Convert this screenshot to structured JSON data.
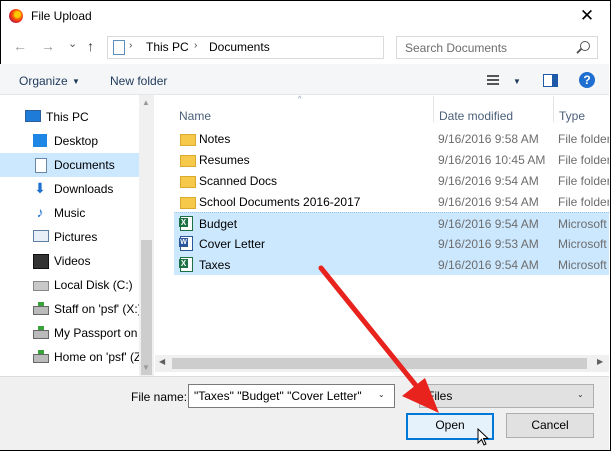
{
  "window": {
    "title": "File Upload",
    "close_glyph": "✕"
  },
  "nav": {
    "back": "←",
    "forward": "→",
    "recent": "⌄",
    "up": "↑"
  },
  "address": {
    "crumbs": [
      "This PC",
      "Documents"
    ],
    "separator": "›",
    "dropdown": "⌄",
    "refresh": "↻"
  },
  "search": {
    "placeholder": "Search Documents"
  },
  "toolbar": {
    "organize": "Organize",
    "caret": "▼",
    "new_folder": "New folder",
    "help": "?"
  },
  "sidebar": {
    "items": [
      {
        "label": "This PC",
        "icon": "computer-icon"
      },
      {
        "label": "Desktop",
        "icon": "desktop-icon"
      },
      {
        "label": "Documents",
        "icon": "documents-icon",
        "selected": true
      },
      {
        "label": "Downloads",
        "icon": "download-icon"
      },
      {
        "label": "Music",
        "icon": "music-icon"
      },
      {
        "label": "Pictures",
        "icon": "pictures-icon"
      },
      {
        "label": "Videos",
        "icon": "videos-icon"
      },
      {
        "label": "Local Disk (C:)",
        "icon": "disk-icon"
      },
      {
        "label": "Staff on 'psf' (X:)",
        "icon": "network-drive-icon"
      },
      {
        "label": "My Passport on",
        "icon": "network-drive-icon"
      },
      {
        "label": "Home on 'psf' (Z",
        "icon": "network-drive-icon"
      }
    ],
    "scroll_up": "▲",
    "scroll_down": "▼"
  },
  "columns": {
    "name": "Name",
    "date": "Date modified",
    "type": "Type",
    "sort_caret": "^"
  },
  "files": [
    {
      "name": "Notes",
      "date": "9/16/2016 9:58 AM",
      "type": "File folder",
      "kind": "folder",
      "selected": false
    },
    {
      "name": "Resumes",
      "date": "9/16/2016 10:45 AM",
      "type": "File folder",
      "kind": "folder",
      "selected": false
    },
    {
      "name": "Scanned Docs",
      "date": "9/16/2016 9:54 AM",
      "type": "File folder",
      "kind": "folder",
      "selected": false
    },
    {
      "name": "School Documents 2016-2017",
      "date": "9/16/2016 9:54 AM",
      "type": "File folder",
      "kind": "folder",
      "selected": false
    },
    {
      "name": "Budget",
      "date": "9/16/2016 9:54 AM",
      "type": "Microsoft",
      "kind": "excel",
      "selected": true
    },
    {
      "name": "Cover Letter",
      "date": "9/16/2016 9:53 AM",
      "type": "Microsoft",
      "kind": "word",
      "selected": true
    },
    {
      "name": "Taxes",
      "date": "9/16/2016 9:54 AM",
      "type": "Microsoft",
      "kind": "excel",
      "selected": true
    }
  ],
  "hscroll": {
    "left": "◀",
    "right": "▶"
  },
  "footer": {
    "file_name_label": "File name:",
    "file_name_value": "\"Taxes\" \"Budget\" \"Cover Letter\"",
    "file_type": "Files",
    "dropdown": "⌄",
    "open": "Open",
    "cancel": "Cancel"
  },
  "colors": {
    "accent": "#0078d7",
    "selection": "#cce8ff",
    "annotation_arrow": "#e8231e"
  }
}
